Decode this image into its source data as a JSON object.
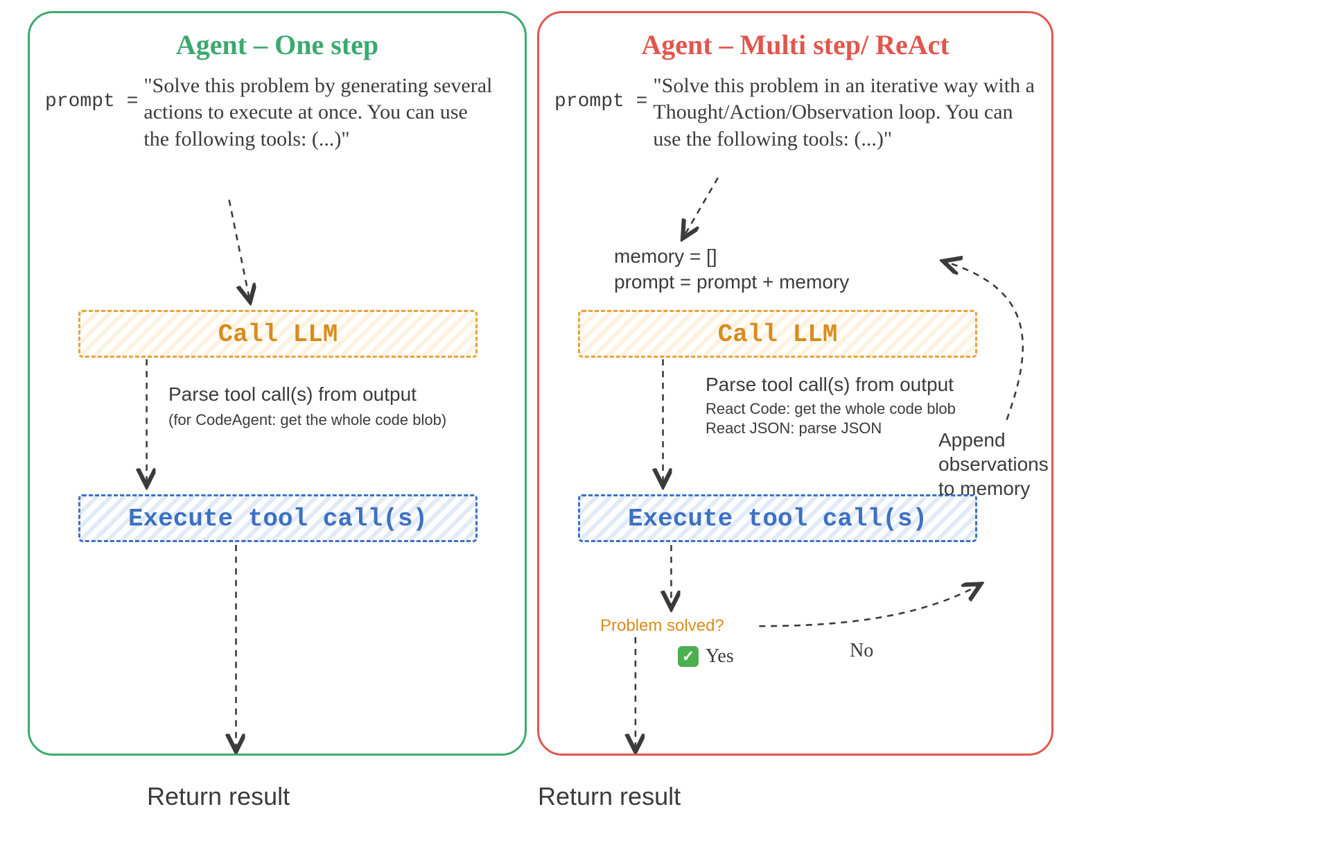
{
  "chart_data": {
    "type": "flowchart",
    "title": "Single-step vs ReAct agent loops",
    "panels": [
      {
        "name": "Agent – One step",
        "color": "#3BA96F",
        "prompt": "\"Solve this problem by generating several actions to execute at once. You can use the following tools: (...)\"",
        "steps": [
          "Call LLM",
          "Execute tool call(s)",
          "Return result"
        ],
        "notes": [
          "Parse tool call(s) from output",
          "(for CodeAgent: get the whole code blob)"
        ]
      },
      {
        "name": "Agent – Multi step/ ReAct",
        "color": "#E0574D",
        "prompt": "\"Solve this problem in an iterative way with a Thought/Action/Observation loop. You can use the following tools: (...)\"",
        "init": [
          "memory = []",
          "prompt = prompt + memory"
        ],
        "steps": [
          "Call LLM",
          "Execute tool call(s)",
          "Return result"
        ],
        "notes": [
          "Parse tool call(s) from output",
          "React Code: get the whole code blob",
          "React JSON: parse JSON"
        ],
        "loop": {
          "question": "Problem solved?",
          "yes": "Yes",
          "no": "No",
          "loop_action": "Append observations to memory"
        }
      }
    ]
  },
  "left": {
    "title": "Agent – One step",
    "prompt_label": "prompt =",
    "prompt_text": "\"Solve this problem by generating several actions to execute at once. You can use the following tools: (...)\"",
    "call_llm": "Call LLM",
    "exec_tool": "Execute tool call(s)",
    "ann1": "Parse tool call(s) from output",
    "ann2": "(for CodeAgent: get the whole code blob)",
    "return": "Return result"
  },
  "right": {
    "title": "Agent – Multi step/ ReAct",
    "prompt_label": "prompt =",
    "prompt_text": "\"Solve this problem in an iterative way with a Thought/Action/Observation loop. You can use the following tools: (...)\"",
    "mem1": "memory = []",
    "mem2": "prompt = prompt + memory",
    "call_llm": "Call LLM",
    "exec_tool": "Execute tool call(s)",
    "ann1": "Parse tool call(s) from output",
    "ann2": "React Code: get the whole code blob",
    "ann3": "React JSON: parse JSON",
    "append": "Append observations to memory",
    "solved": "Problem solved?",
    "yes": "Yes",
    "no": "No",
    "return": "Return result"
  }
}
